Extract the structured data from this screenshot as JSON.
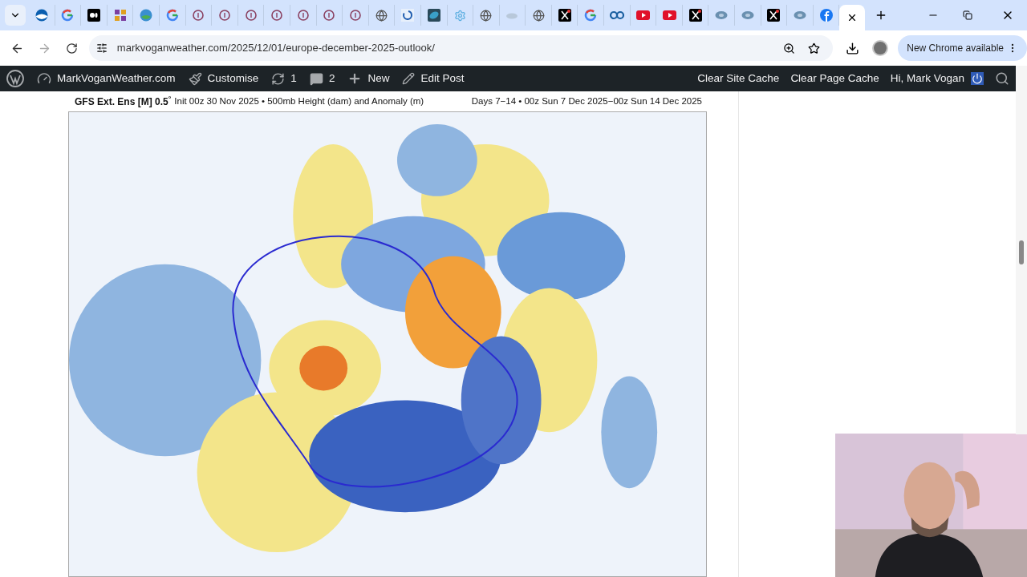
{
  "tabs": [
    {
      "kind": "noaa",
      "selected": false
    },
    {
      "kind": "google",
      "selected": false
    },
    {
      "kind": "medium",
      "selected": false
    },
    {
      "kind": "ua",
      "selected": false
    },
    {
      "kind": "earth",
      "selected": false
    },
    {
      "kind": "google",
      "selected": false
    },
    {
      "kind": "ring",
      "selected": false
    },
    {
      "kind": "ring",
      "selected": false
    },
    {
      "kind": "ring",
      "selected": false
    },
    {
      "kind": "ring",
      "selected": false
    },
    {
      "kind": "ring",
      "selected": false
    },
    {
      "kind": "ring",
      "selected": false
    },
    {
      "kind": "ring",
      "selected": false
    },
    {
      "kind": "globe",
      "selected": false
    },
    {
      "kind": "swirl",
      "selected": false
    },
    {
      "kind": "satellite",
      "selected": false
    },
    {
      "kind": "gear",
      "selected": false
    },
    {
      "kind": "globe",
      "selected": false
    },
    {
      "kind": "faded",
      "selected": false
    },
    {
      "kind": "globe",
      "selected": false
    },
    {
      "kind": "x",
      "selected": false
    },
    {
      "kind": "google",
      "selected": false
    },
    {
      "kind": "cc",
      "selected": false
    },
    {
      "kind": "youtube",
      "selected": false
    },
    {
      "kind": "youtube",
      "selected": false
    },
    {
      "kind": "x",
      "selected": false
    },
    {
      "kind": "storm",
      "selected": false
    },
    {
      "kind": "storm",
      "selected": false
    },
    {
      "kind": "x",
      "selected": false
    },
    {
      "kind": "storm",
      "selected": false
    },
    {
      "kind": "facebook",
      "selected": false
    },
    {
      "kind": "blank",
      "selected": true
    }
  ],
  "address": {
    "url": "markvoganweather.com/2025/12/01/europe-december-2025-outlook/"
  },
  "update_button": "New Chrome available",
  "admin_bar": {
    "left": [
      {
        "kind": "site",
        "label": "MarkVoganWeather.com"
      },
      {
        "kind": "brush",
        "label": "Customise"
      },
      {
        "kind": "updates",
        "label": "1"
      },
      {
        "kind": "comments",
        "label": "2"
      },
      {
        "kind": "plus",
        "label": "New"
      },
      {
        "kind": "pencil",
        "label": "Edit Post"
      }
    ],
    "right": [
      "Clear Site Cache",
      "Clear Page Cache",
      "Hi, Mark Vogan"
    ]
  },
  "chart_header": {
    "title": "GFS Ext.  Ens [M] 0.5$^{°}$",
    "subtitle": "Init 00z 30 Nov 2025 • 500mb Height (dam) and Anomaly (m)",
    "range": "Days 7−14 • 00z Sun 7 Dec 2025−00z Sun 14 Dec 2025"
  }
}
